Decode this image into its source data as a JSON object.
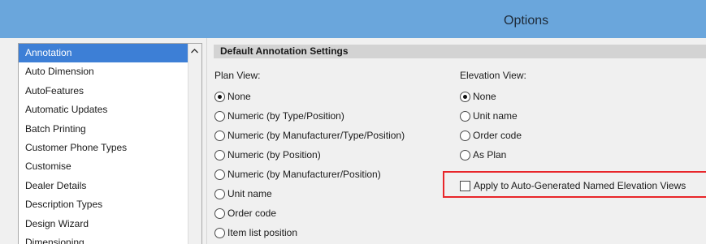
{
  "window": {
    "title": "Options"
  },
  "sidebar": {
    "items": [
      {
        "label": "Annotation",
        "selected": true
      },
      {
        "label": "Auto Dimension"
      },
      {
        "label": "AutoFeatures"
      },
      {
        "label": "Automatic Updates"
      },
      {
        "label": "Batch Printing"
      },
      {
        "label": "Customer Phone Types"
      },
      {
        "label": "Customise"
      },
      {
        "label": "Dealer Details"
      },
      {
        "label": "Description Types"
      },
      {
        "label": "Design Wizard"
      },
      {
        "label": "Dimensioning"
      }
    ],
    "scroll_up_icon": "caret-up-icon"
  },
  "main": {
    "section_title": "Default Annotation Settings",
    "plan_view": {
      "label": "Plan View:",
      "options": [
        {
          "label": "None",
          "checked": true
        },
        {
          "label": "Numeric (by Type/Position)"
        },
        {
          "label": "Numeric (by Manufacturer/Type/Position)"
        },
        {
          "label": "Numeric (by Position)"
        },
        {
          "label": "Numeric (by Manufacturer/Position)"
        },
        {
          "label": "Unit name"
        },
        {
          "label": "Order code"
        },
        {
          "label": "Item list position"
        }
      ]
    },
    "elevation_view": {
      "label": "Elevation View:",
      "options": [
        {
          "label": "None",
          "checked": true
        },
        {
          "label": "Unit name"
        },
        {
          "label": "Order code"
        },
        {
          "label": "As Plan"
        }
      ]
    },
    "apply_checkbox": {
      "label": "Apply to Auto-Generated Named Elevation Views",
      "checked": false
    }
  },
  "colors": {
    "titlebar": "#6aa6dc",
    "selection": "#3d7fd6",
    "highlight_border": "#e8262a"
  }
}
